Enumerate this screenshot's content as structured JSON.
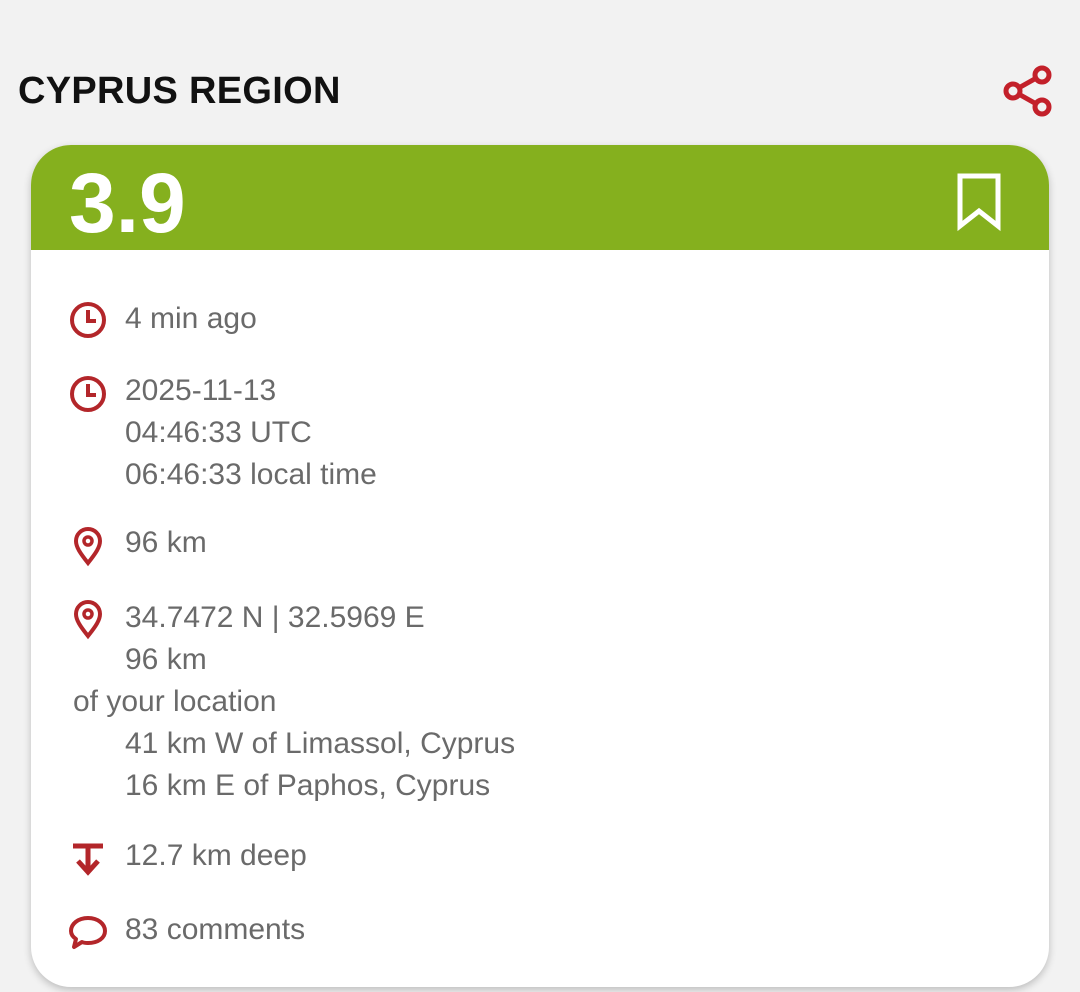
{
  "region": {
    "title": "CYPRUS REGION"
  },
  "quake": {
    "magnitude": "3.9",
    "ago": "4 min ago",
    "date": "2025-11-13",
    "utc": "04:46:33 UTC",
    "local": "06:46:33 local time",
    "distance": "96 km",
    "coords": "34.7472 N | 32.5969 E",
    "distance_line": "96 km",
    "distance_suffix": "of your location",
    "near1": "41 km W of Limassol, Cyprus",
    "near2": "16 km E of Paphos, Cyprus",
    "depth": "12.7 km deep",
    "comments": "83  comments"
  },
  "colors": {
    "magnitude_band": "#85b01e",
    "icon_red": "#b3262a",
    "text_gray": "#6a6a6a"
  },
  "icons": {
    "share": "share-icon",
    "bookmark": "bookmark-icon",
    "clock": "clock-icon",
    "pin": "location-pin-icon",
    "depth": "depth-arrow-icon",
    "comment": "comment-bubble-icon"
  }
}
